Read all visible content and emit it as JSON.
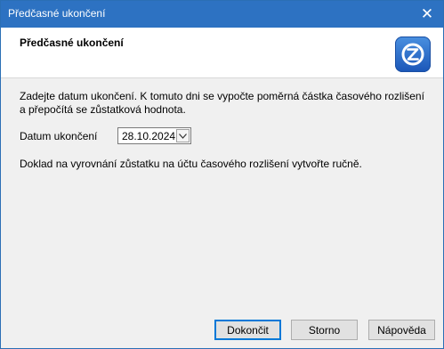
{
  "window": {
    "title": "Předčasné ukončení",
    "close_glyph": "✕"
  },
  "header": {
    "heading": "Předčasné ukončení",
    "logo_icon": "app-logo-icon"
  },
  "content": {
    "description": "Zadejte datum ukončení. K tomuto dni se vypočte poměrná částka časového rozlišení a přepočítá se zůstatková hodnota.",
    "date_label": "Datum ukončení",
    "date_value": "28.10.2024",
    "note": "Doklad na vyrovnání zůstatku na účtu časového rozlišení vytvořte ručně."
  },
  "buttons": {
    "finish": "Dokončit",
    "cancel": "Storno",
    "help": "Nápověda"
  },
  "colors": {
    "titlebar": "#2d72c2",
    "accent": "#0078d7",
    "logo": "#2a6fd0"
  }
}
